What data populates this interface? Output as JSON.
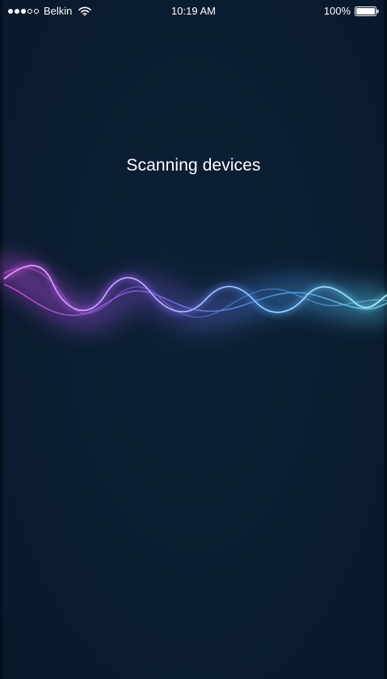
{
  "status_bar": {
    "signal_strength": {
      "filled": 3,
      "total": 5
    },
    "carrier": "Belkin",
    "time": "10:19 AM",
    "battery_percent": "100%",
    "battery_level": 1.0,
    "icons": [
      "signal-dots-icon",
      "wifi-icon",
      "battery-icon"
    ]
  },
  "main": {
    "title": "Scanning devices"
  },
  "colors": {
    "background": "#0a1c30",
    "wave_purple": "#b546d6",
    "wave_blue": "#3e8fd8",
    "wave_teal": "#5fc8e0",
    "wave_highlight": "#e6f2ff",
    "text": "#ffffff"
  }
}
